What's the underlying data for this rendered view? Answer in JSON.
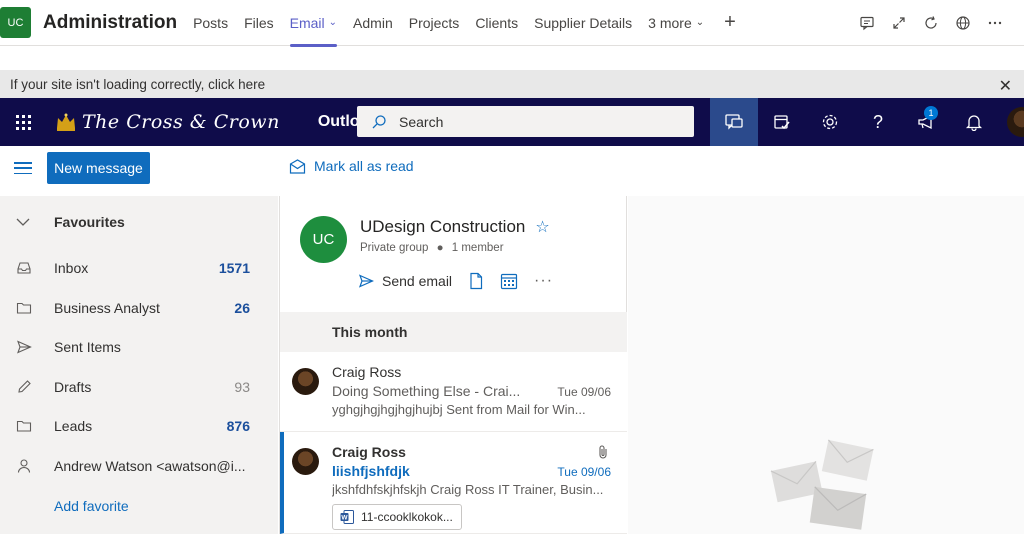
{
  "teams_header": {
    "team_avatar": "UC",
    "team_name": "Administration",
    "tabs": [
      {
        "label": "Posts"
      },
      {
        "label": "Files"
      },
      {
        "label": "Email",
        "active": true
      },
      {
        "label": "Admin"
      },
      {
        "label": "Projects"
      },
      {
        "label": "Clients"
      },
      {
        "label": "Supplier Details"
      },
      {
        "label": "3 more"
      }
    ],
    "right_icons": [
      "conversation-icon",
      "expand-icon",
      "refresh-icon",
      "globe-icon",
      "more-icon"
    ]
  },
  "notice": {
    "text": "If your site isn't loading correctly, click here"
  },
  "outlook_bar": {
    "brand": "The Cross & Crown",
    "app_name": "Outlook",
    "search_placeholder": "Search",
    "notification_count": "1"
  },
  "command_bar": {
    "new_message": "New message",
    "mark_all_read": "Mark all as read"
  },
  "folders": {
    "favourites_label": "Favourites",
    "items": [
      {
        "name": "Inbox",
        "count": "1571",
        "icon": "inbox-icon"
      },
      {
        "name": "Business Analyst",
        "count": "26",
        "icon": "folder-icon"
      },
      {
        "name": "Sent Items",
        "count": "",
        "icon": "send-icon"
      },
      {
        "name": "Drafts",
        "count": "93",
        "icon": "pencil-icon"
      },
      {
        "name": "Leads",
        "count": "876",
        "icon": "folder-icon"
      },
      {
        "name": "Andrew Watson <awatson@i...",
        "count": "",
        "icon": "person-icon"
      }
    ],
    "add_favorite": "Add favorite"
  },
  "group_card": {
    "avatar": "UC",
    "name": "UDesign Construction",
    "privacy": "Private group",
    "members": "1 member",
    "send_email": "Send email"
  },
  "message_list": {
    "section": "This month",
    "messages": [
      {
        "from": "Craig Ross",
        "subject": "Doing Something Else - Crai...",
        "date": "Tue 09/06",
        "preview": "yghgjhgjhgjhgjhujbj Sent from Mail for Win..."
      },
      {
        "from": "Craig Ross",
        "subject": "liishfjshfdjk",
        "date": "Tue 09/06",
        "preview": "jkshfdhfskjhfskjh Craig Ross IT Trainer, Busin...",
        "attachment": "11-ccooklkokok..."
      }
    ]
  },
  "colors": {
    "accent": "#0f6cbd",
    "suite_bar": "#0f0c4a",
    "teams_accent": "#5b5fc7"
  }
}
